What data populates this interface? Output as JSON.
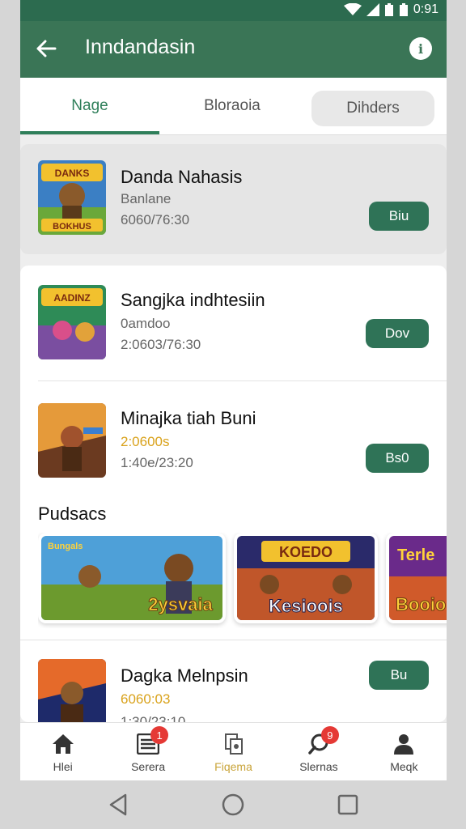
{
  "status": {
    "time": "0:91"
  },
  "appbar": {
    "title": "Inndandasin",
    "back_icon": "arrow-left-icon",
    "info_icon": "info-icon"
  },
  "tabs": [
    {
      "label": "Nage",
      "active": true
    },
    {
      "label": "Bloraoia",
      "active": false
    },
    {
      "label": "Dihders",
      "active": false
    }
  ],
  "featured": {
    "name": "Danda Nahasis",
    "sub": "Banlane",
    "time": "6060/76:30",
    "button": "Biu",
    "thumb_label_top": "DANKS",
    "thumb_label_bottom": "BOKHUS"
  },
  "list": [
    {
      "name": "Sangjka indhtesiin",
      "sub": "0amdoo",
      "time": "2:0603/76:30",
      "button": "Dov",
      "thumb_label": "AADINZ"
    },
    {
      "name": "Minajka tiah Buni",
      "sub": "2:0600s",
      "time": "1:40e/23:20",
      "button": "Bs0"
    }
  ],
  "section": {
    "title": "Pudsacs"
  },
  "banners": [
    {
      "label": "2ysvaia",
      "tag": "Bungals"
    },
    {
      "label": "Kesioois",
      "tag": "KOEDO"
    },
    {
      "label": "Booio",
      "tag": "Terle"
    }
  ],
  "last_item": {
    "name": "Dagka Melnpsin",
    "sub": "6060:03",
    "time": "1:30/23:10",
    "button": "Bu"
  },
  "bottomnav": [
    {
      "label": "Hlei",
      "icon": "home-icon",
      "badge": ""
    },
    {
      "label": "Serera",
      "icon": "list-icon",
      "badge": "1"
    },
    {
      "label": "Fiqema",
      "icon": "documents-icon",
      "badge": ""
    },
    {
      "label": "Slernas",
      "icon": "search-icon",
      "badge": "9"
    },
    {
      "label": "Meqk",
      "icon": "person-icon",
      "badge": ""
    }
  ],
  "colors": {
    "primary": "#3a7556",
    "button": "#2f7357",
    "accent": "#c9a43a",
    "badge": "#e53935"
  }
}
